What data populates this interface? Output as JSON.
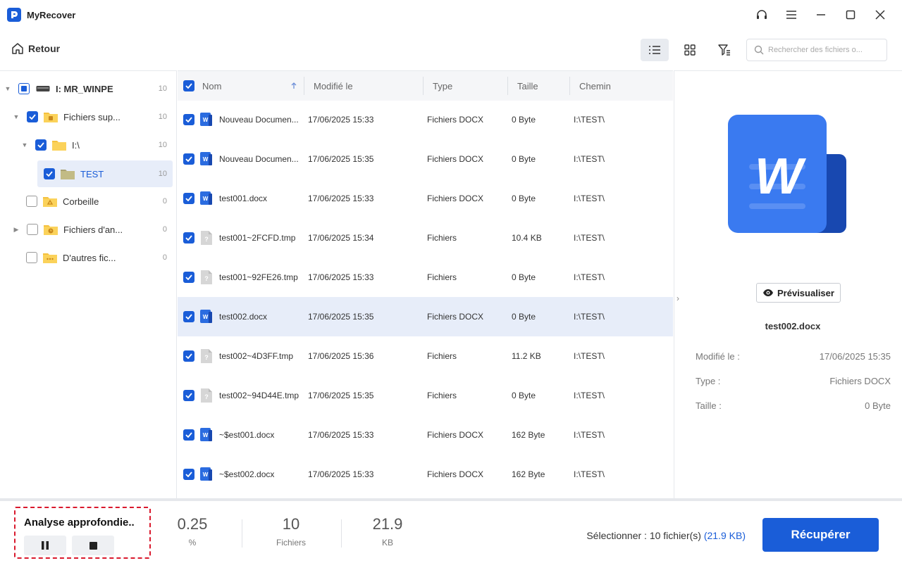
{
  "app": {
    "title": "MyRecover"
  },
  "toolbar": {
    "back_label": "Retour",
    "search_placeholder": "Rechercher des fichiers o..."
  },
  "tree": {
    "items": [
      {
        "label": "I: MR_WINPE",
        "count": "10",
        "checked": "partial",
        "icon": "drive-icon"
      },
      {
        "label": "Fichiers sup...",
        "count": "10",
        "checked": "checked",
        "icon": "deleted-folder-icon"
      },
      {
        "label": "I:\\",
        "count": "10",
        "checked": "checked",
        "icon": "folder-icon"
      },
      {
        "label": "TEST",
        "count": "10",
        "checked": "checked",
        "icon": "folder-icon"
      },
      {
        "label": "Corbeille",
        "count": "0",
        "checked": "empty",
        "icon": "recycle-bin-icon"
      },
      {
        "label": "Fichiers d'an...",
        "count": "0",
        "checked": "empty",
        "icon": "history-folder-icon"
      },
      {
        "label": "D'autres fic...",
        "count": "0",
        "checked": "empty",
        "icon": "other-folder-icon"
      }
    ]
  },
  "table": {
    "headers": {
      "name": "Nom",
      "modified": "Modifié le",
      "type": "Type",
      "size": "Taille",
      "path": "Chemin"
    },
    "rows": [
      {
        "name": "Nouveau Documen...",
        "modified": "17/06/2025 15:33",
        "type": "Fichiers DOCX",
        "size": "0 Byte",
        "path": "I:\\TEST\\",
        "icon": "word-file-icon"
      },
      {
        "name": "Nouveau Documen...",
        "modified": "17/06/2025 15:35",
        "type": "Fichiers DOCX",
        "size": "0 Byte",
        "path": "I:\\TEST\\",
        "icon": "word-file-icon"
      },
      {
        "name": "test001.docx",
        "modified": "17/06/2025 15:33",
        "type": "Fichiers DOCX",
        "size": "0 Byte",
        "path": "I:\\TEST\\",
        "icon": "word-file-icon"
      },
      {
        "name": "test001~2FCFD.tmp",
        "modified": "17/06/2025 15:34",
        "type": "Fichiers",
        "size": "10.4 KB",
        "path": "I:\\TEST\\",
        "icon": "unknown-file-icon"
      },
      {
        "name": "test001~92FE26.tmp",
        "modified": "17/06/2025 15:33",
        "type": "Fichiers",
        "size": "0 Byte",
        "path": "I:\\TEST\\",
        "icon": "unknown-file-icon"
      },
      {
        "name": "test002.docx",
        "modified": "17/06/2025 15:35",
        "type": "Fichiers DOCX",
        "size": "0 Byte",
        "path": "I:\\TEST\\",
        "icon": "word-file-icon"
      },
      {
        "name": "test002~4D3FF.tmp",
        "modified": "17/06/2025 15:36",
        "type": "Fichiers",
        "size": "11.2 KB",
        "path": "I:\\TEST\\",
        "icon": "unknown-file-icon"
      },
      {
        "name": "test002~94D44E.tmp",
        "modified": "17/06/2025 15:35",
        "type": "Fichiers",
        "size": "0 Byte",
        "path": "I:\\TEST\\",
        "icon": "unknown-file-icon"
      },
      {
        "name": "~$est001.docx",
        "modified": "17/06/2025 15:33",
        "type": "Fichiers DOCX",
        "size": "162 Byte",
        "path": "I:\\TEST\\",
        "icon": "word-file-icon"
      },
      {
        "name": "~$est002.docx",
        "modified": "17/06/2025 15:33",
        "type": "Fichiers DOCX",
        "size": "162 Byte",
        "path": "I:\\TEST\\",
        "icon": "word-file-icon"
      }
    ]
  },
  "preview": {
    "preview_label": "Prévisualiser",
    "file_name": "test002.docx",
    "modified_label": "Modifié le :",
    "modified_value": "17/06/2025 15:35",
    "type_label": "Type :",
    "type_value": "Fichiers DOCX",
    "size_label": "Taille :",
    "size_value": "0 Byte"
  },
  "footer": {
    "scan_title": "Analyse approfondie..",
    "percent_value": "0.25",
    "percent_label": "%",
    "files_value": "10",
    "files_label": "Fichiers",
    "size_value": "21.9",
    "size_label": "KB",
    "selection_text": "Sélectionner : 10 fichier(s)",
    "selection_size": "(21.9 KB)",
    "recover_label": "Récupérer"
  },
  "colors": {
    "accent": "#1a5dd8",
    "highlight": "#e7edf9",
    "scan_border": "#d9192d"
  }
}
